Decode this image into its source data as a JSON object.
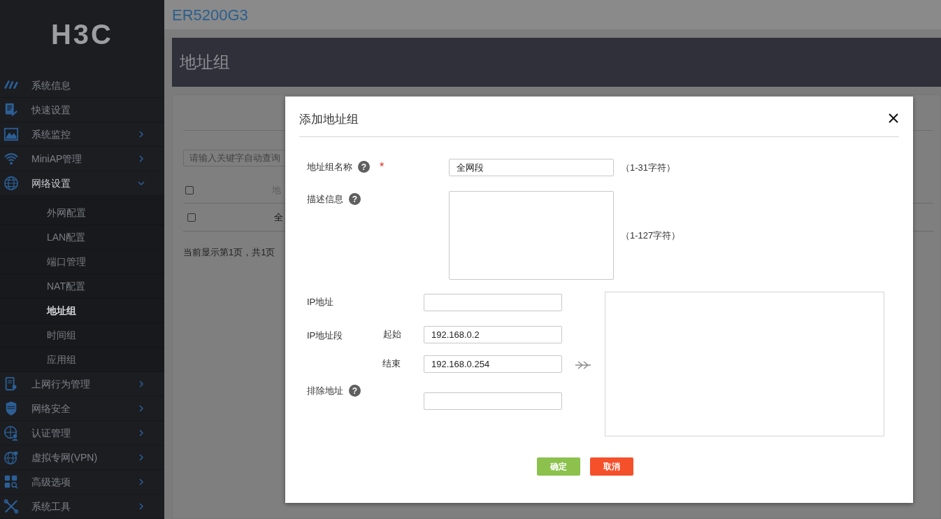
{
  "logo": "H3C",
  "sidebar": {
    "items": [
      {
        "kind": "link",
        "label": "系统信息"
      },
      {
        "kind": "link",
        "label": "快速设置"
      },
      {
        "kind": "menu",
        "label": "系统监控",
        "expanded": false
      },
      {
        "kind": "menu",
        "label": "MiniAP管理",
        "expanded": false
      },
      {
        "kind": "menu",
        "label": "网络设置",
        "expanded": true,
        "children": [
          {
            "label": "外网配置",
            "selected": false
          },
          {
            "label": "LAN配置",
            "selected": false
          },
          {
            "label": "端口管理",
            "selected": false
          },
          {
            "label": "NAT配置",
            "selected": false
          },
          {
            "label": "地址组",
            "selected": true
          },
          {
            "label": "时间组",
            "selected": false
          },
          {
            "label": "应用组",
            "selected": false
          }
        ]
      },
      {
        "kind": "menu",
        "label": "上网行为管理",
        "expanded": false
      },
      {
        "kind": "menu",
        "label": "网络安全",
        "expanded": false
      },
      {
        "kind": "menu",
        "label": "认证管理",
        "expanded": false
      },
      {
        "kind": "menu",
        "label": "虚拟专网(VPN)",
        "expanded": false
      },
      {
        "kind": "menu",
        "label": "高级选项",
        "expanded": false
      },
      {
        "kind": "menu",
        "label": "系统工具",
        "expanded": false
      }
    ]
  },
  "page": {
    "device": "ER5200G3",
    "title": "地址组",
    "search": {
      "placeholder": "请输入关键字自动查询"
    },
    "table": {
      "header": {
        "checked": false,
        "column_2": "地"
      },
      "rows": [
        {
          "checked": false,
          "column_2": "全"
        }
      ]
    },
    "pagination": "当前显示第1页，共1页"
  },
  "dialog": {
    "title": "添加地址组",
    "name": {
      "label": "地址组名称",
      "help": "?",
      "required": "*",
      "value": "全网段",
      "hint": "（1-31字符）"
    },
    "description": {
      "label": "描述信息",
      "help": "?",
      "hint": "（1-127字符）"
    },
    "ip_address": {
      "label": "IP地址"
    },
    "ip_range": {
      "label": "IP地址段",
      "start_label": "起始",
      "start_value": "192.168.0.2",
      "end_label": "结束",
      "end_value": "192.168.0.254"
    },
    "exclude": {
      "label": "排除地址",
      "help": "?"
    },
    "buttons": [
      {
        "kind": "primary",
        "label": "确定"
      },
      {
        "kind": "cancel",
        "label": "取消"
      }
    ]
  }
}
